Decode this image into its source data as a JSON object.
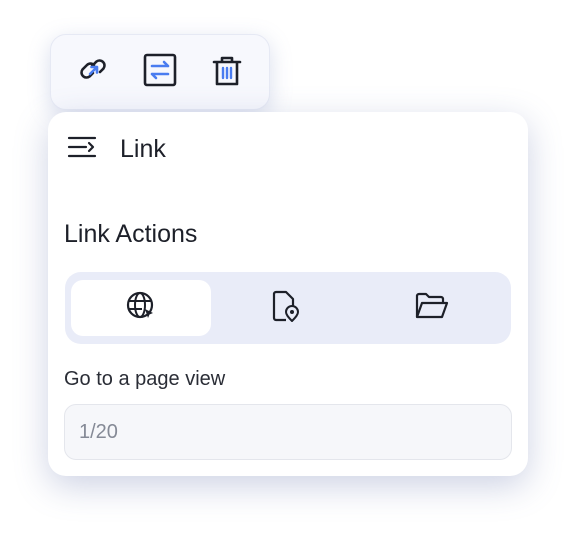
{
  "toolbar": {
    "icons": [
      "link-icon",
      "adjust-icon",
      "trash-icon"
    ],
    "accent_color": "#4a7cf0"
  },
  "panel": {
    "title": "Link",
    "menu_icon": "collapse-menu-icon"
  },
  "link_actions": {
    "title": "Link Actions",
    "options": [
      {
        "icon": "globe-icon",
        "selected": true
      },
      {
        "icon": "page-location-icon",
        "selected": false
      },
      {
        "icon": "folder-open-icon",
        "selected": false
      }
    ]
  },
  "page_view": {
    "label": "Go to a page view",
    "placeholder": "1/20",
    "value": ""
  }
}
